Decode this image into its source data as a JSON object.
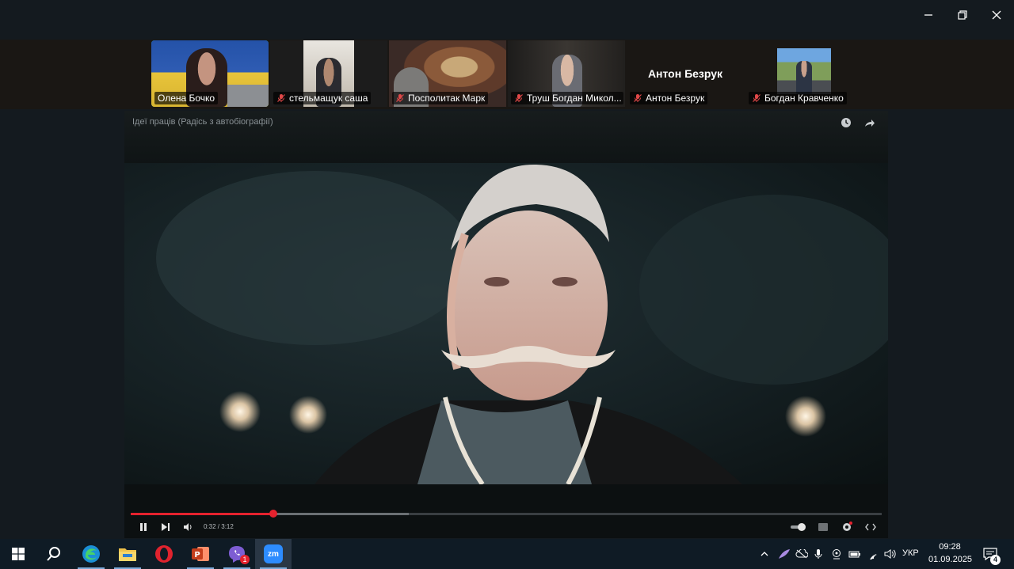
{
  "window": {
    "controls": [
      "minimize",
      "restore",
      "close"
    ]
  },
  "participants": [
    {
      "name": "Олена Бочко",
      "muted": false,
      "active_speaker": true,
      "video": true
    },
    {
      "name": "стельмащук саша",
      "muted": true,
      "active_speaker": false,
      "video": true
    },
    {
      "name": "Посполитак Марк",
      "muted": true,
      "active_speaker": false,
      "video": true
    },
    {
      "name": "Труш Богдан Микол...",
      "muted": true,
      "active_speaker": false,
      "video": true
    },
    {
      "name": "Антон Безрук",
      "muted": true,
      "active_speaker": false,
      "video": false,
      "display_name": "Антон Безрук"
    },
    {
      "name": "Богдан Кравченко",
      "muted": true,
      "active_speaker": false,
      "video": true
    }
  ],
  "shared_video": {
    "title": "Ідеї праців (Радісь з автобіографії)",
    "time": "0:32 / 3:12",
    "progress": 0.19,
    "buffered": 0.37,
    "accent_color": "#e5222e"
  },
  "taskbar": {
    "apps": [
      "start",
      "search",
      "edge",
      "file-explorer",
      "opera",
      "powerpoint",
      "viber",
      "zoom"
    ],
    "viber_badge": "1",
    "zoom_label": "zm",
    "language": "УКР",
    "time": "09:28",
    "date": "01.09.2025",
    "notifications": "4"
  },
  "colors": {
    "active_border": "#22c55e",
    "muted_icon": "#e04848",
    "taskbar": "#0f1b25"
  }
}
